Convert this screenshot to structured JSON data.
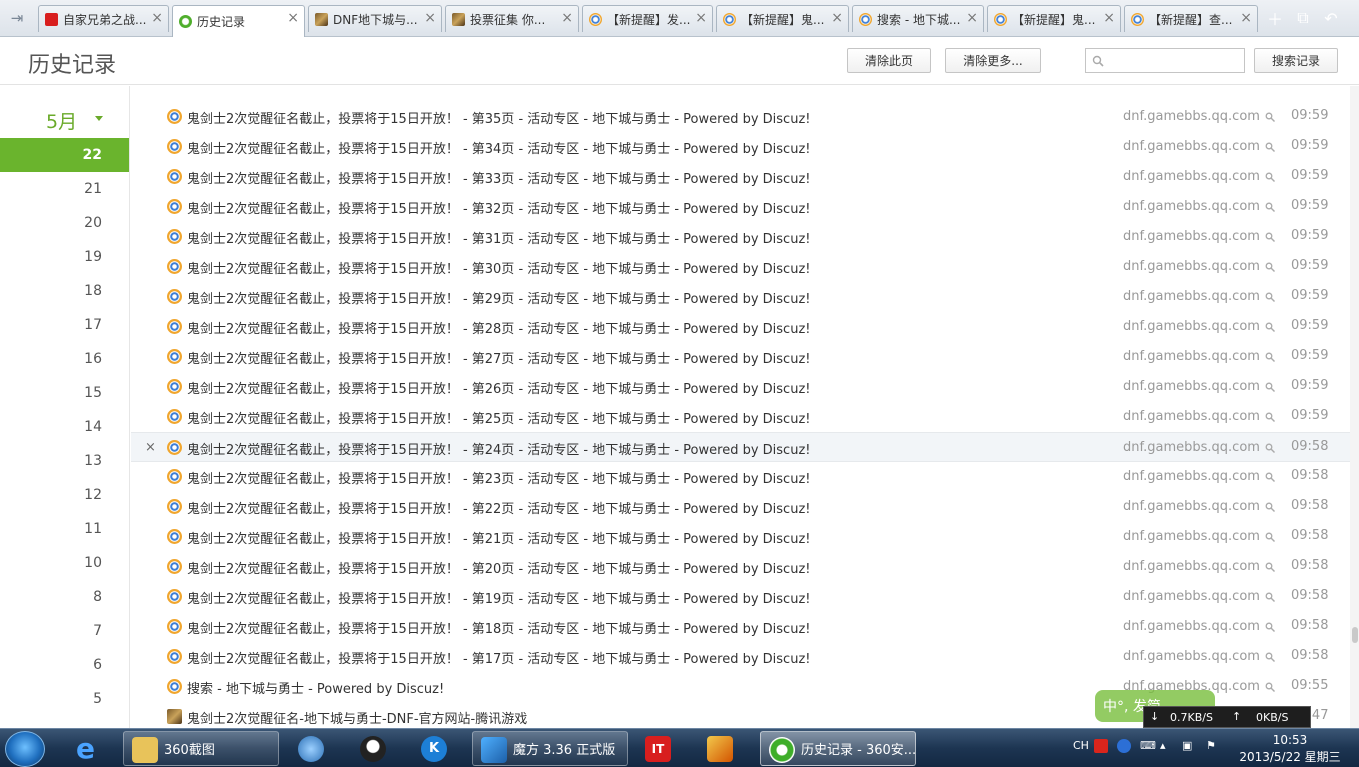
{
  "tabs": [
    {
      "title": "自家兄弟之战...",
      "icon": "it168-icon"
    },
    {
      "title": "历史记录",
      "icon": "history-clock-icon",
      "active": true
    },
    {
      "title": "DNF地下城与...",
      "icon": "dnf-game-icon"
    },
    {
      "title": "投票征集 你...",
      "icon": "dnf-game-icon"
    },
    {
      "title": "【新提醒】发...",
      "icon": "discuz-icon"
    },
    {
      "title": "【新提醒】鬼...",
      "icon": "discuz-icon"
    },
    {
      "title": "搜索 - 地下城...",
      "icon": "discuz-icon"
    },
    {
      "title": "【新提醒】鬼...",
      "icon": "discuz-icon"
    },
    {
      "title": "【新提醒】查...",
      "icon": "discuz-icon"
    }
  ],
  "header": {
    "title": "历史记录",
    "clear_page_label": "清除此页",
    "clear_more_label": "清除更多...",
    "search_placeholder": "",
    "search_button_label": "搜索记录"
  },
  "sidebar": {
    "month": "5月",
    "days": [
      "22",
      "21",
      "20",
      "19",
      "18",
      "17",
      "16",
      "15",
      "14",
      "13",
      "12",
      "11",
      "10",
      "8",
      "7",
      "6",
      "5"
    ],
    "selected_day": "22"
  },
  "history": [
    {
      "title": "鬼剑士2次觉醒征名截止，投票将于15日开放！ - 第35页 - 活动专区 - 地下城与勇士 - Powered by Discuz!",
      "domain": "dnf.gamebbs.qq.com",
      "time": "09:59"
    },
    {
      "title": "鬼剑士2次觉醒征名截止，投票将于15日开放！ - 第34页 - 活动专区 - 地下城与勇士 - Powered by Discuz!",
      "domain": "dnf.gamebbs.qq.com",
      "time": "09:59"
    },
    {
      "title": "鬼剑士2次觉醒征名截止，投票将于15日开放！ - 第33页 - 活动专区 - 地下城与勇士 - Powered by Discuz!",
      "domain": "dnf.gamebbs.qq.com",
      "time": "09:59"
    },
    {
      "title": "鬼剑士2次觉醒征名截止，投票将于15日开放！ - 第32页 - 活动专区 - 地下城与勇士 - Powered by Discuz!",
      "domain": "dnf.gamebbs.qq.com",
      "time": "09:59"
    },
    {
      "title": "鬼剑士2次觉醒征名截止，投票将于15日开放！ - 第31页 - 活动专区 - 地下城与勇士 - Powered by Discuz!",
      "domain": "dnf.gamebbs.qq.com",
      "time": "09:59"
    },
    {
      "title": "鬼剑士2次觉醒征名截止，投票将于15日开放！ - 第30页 - 活动专区 - 地下城与勇士 - Powered by Discuz!",
      "domain": "dnf.gamebbs.qq.com",
      "time": "09:59"
    },
    {
      "title": "鬼剑士2次觉醒征名截止，投票将于15日开放！ - 第29页 - 活动专区 - 地下城与勇士 - Powered by Discuz!",
      "domain": "dnf.gamebbs.qq.com",
      "time": "09:59"
    },
    {
      "title": "鬼剑士2次觉醒征名截止，投票将于15日开放！ - 第28页 - 活动专区 - 地下城与勇士 - Powered by Discuz!",
      "domain": "dnf.gamebbs.qq.com",
      "time": "09:59"
    },
    {
      "title": "鬼剑士2次觉醒征名截止，投票将于15日开放！ - 第27页 - 活动专区 - 地下城与勇士 - Powered by Discuz!",
      "domain": "dnf.gamebbs.qq.com",
      "time": "09:59"
    },
    {
      "title": "鬼剑士2次觉醒征名截止，投票将于15日开放！ - 第26页 - 活动专区 - 地下城与勇士 - Powered by Discuz!",
      "domain": "dnf.gamebbs.qq.com",
      "time": "09:59"
    },
    {
      "title": "鬼剑士2次觉醒征名截止，投票将于15日开放！ - 第25页 - 活动专区 - 地下城与勇士 - Powered by Discuz!",
      "domain": "dnf.gamebbs.qq.com",
      "time": "09:59"
    },
    {
      "title": "鬼剑士2次觉醒征名截止，投票将于15日开放！ - 第24页 - 活动专区 - 地下城与勇士 - Powered by Discuz!",
      "domain": "dnf.gamebbs.qq.com",
      "time": "09:58",
      "hover": true
    },
    {
      "title": "鬼剑士2次觉醒征名截止，投票将于15日开放！ - 第23页 - 活动专区 - 地下城与勇士 - Powered by Discuz!",
      "domain": "dnf.gamebbs.qq.com",
      "time": "09:58"
    },
    {
      "title": "鬼剑士2次觉醒征名截止，投票将于15日开放！ - 第22页 - 活动专区 - 地下城与勇士 - Powered by Discuz!",
      "domain": "dnf.gamebbs.qq.com",
      "time": "09:58"
    },
    {
      "title": "鬼剑士2次觉醒征名截止，投票将于15日开放！ - 第21页 - 活动专区 - 地下城与勇士 - Powered by Discuz!",
      "domain": "dnf.gamebbs.qq.com",
      "time": "09:58"
    },
    {
      "title": "鬼剑士2次觉醒征名截止，投票将于15日开放！ - 第20页 - 活动专区 - 地下城与勇士 - Powered by Discuz!",
      "domain": "dnf.gamebbs.qq.com",
      "time": "09:58"
    },
    {
      "title": "鬼剑士2次觉醒征名截止，投票将于15日开放！ - 第19页 - 活动专区 - 地下城与勇士 - Powered by Discuz!",
      "domain": "dnf.gamebbs.qq.com",
      "time": "09:58"
    },
    {
      "title": "鬼剑士2次觉醒征名截止，投票将于15日开放！ - 第18页 - 活动专区 - 地下城与勇士 - Powered by Discuz!",
      "domain": "dnf.gamebbs.qq.com",
      "time": "09:58"
    },
    {
      "title": "鬼剑士2次觉醒征名截止，投票将于15日开放！ - 第17页 - 活动专区 - 地下城与勇士 - Powered by Discuz!",
      "domain": "dnf.gamebbs.qq.com",
      "time": "09:58"
    },
    {
      "title": "搜索 - 地下城与勇士 - Powered by Discuz!",
      "domain": "dnf.gamebbs.qq.com",
      "time": "09:55"
    },
    {
      "title": "鬼剑士2次觉醒征名-地下城与勇士-DNF-官方网站-腾讯游戏",
      "domain": "",
      "time": "09:47",
      "icon": "dnf-game-icon"
    }
  ],
  "ime_badge": "中°, 发简",
  "netspeed": {
    "down": "0.7KB/S",
    "up": "0KB/S"
  },
  "taskbar": {
    "items": [
      {
        "label": "360截图",
        "icon": "folder-icon"
      },
      {
        "label": "魔方 3.36 正式版",
        "icon": "mofang-icon"
      },
      {
        "label": "历史记录 - 360安...",
        "icon": "360-browser-icon"
      }
    ],
    "tray_lang": "CH",
    "clock_time": "10:53",
    "clock_date": "2013/5/22 星期三"
  }
}
